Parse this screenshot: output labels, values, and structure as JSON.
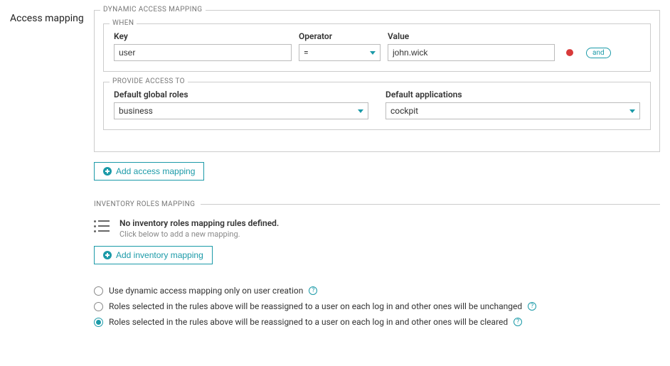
{
  "page_title": "Access mapping",
  "dynamic": {
    "legend": "DYNAMIC ACCESS MAPPING",
    "when": {
      "legend": "WHEN",
      "key_label": "Key",
      "operator_label": "Operator",
      "value_label": "Value",
      "key_value": "user",
      "operator_value": "=",
      "value_value": "john.wick",
      "and_chip": "and"
    },
    "provide": {
      "legend": "PROVIDE ACCESS TO",
      "roles_label": "Default global roles",
      "apps_label": "Default applications",
      "roles_value": "business",
      "apps_value": "cockpit"
    },
    "add_label": "Add access mapping"
  },
  "inventory": {
    "heading": "INVENTORY ROLES MAPPING",
    "empty_title": "No inventory roles mapping rules defined.",
    "empty_sub": "Click below to add a new mapping.",
    "add_label": "Add inventory mapping"
  },
  "radios": {
    "opt1": "Use dynamic access mapping only on user creation",
    "opt2": "Roles selected in the rules above will be reassigned to a user on each log in and other ones will be unchanged",
    "opt3": "Roles selected in the rules above will be reassigned to a user on each log in and other ones will be cleared",
    "selected": "opt3"
  }
}
